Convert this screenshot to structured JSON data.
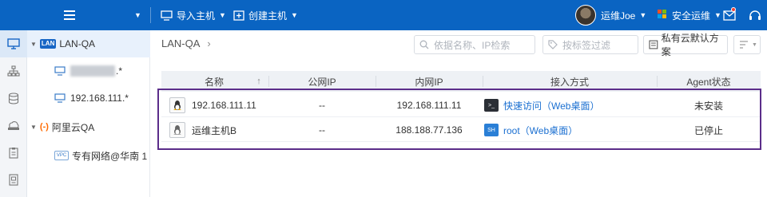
{
  "topbar": {
    "import_host": "导入主机",
    "create_host": "创建主机",
    "user_name": "运维Joe",
    "app_switch": "安全运维",
    "colors": {
      "bar": "#0a64c2",
      "badge": "#f04134"
    }
  },
  "rail": [
    "desktop-icon",
    "network-icon",
    "database-icon",
    "cloud-drive-icon",
    "clipboard-icon",
    "document-icon"
  ],
  "tree": {
    "groups": [
      {
        "tag": "LAN",
        "label": "LAN-QA",
        "children": [
          {
            "label": ".*"
          },
          {
            "label": "192.168.111.*"
          }
        ]
      },
      {
        "tag": "(-)",
        "label": "阿里云QA",
        "children": [
          {
            "tag": "VPC",
            "label": "专有网络@华南 1"
          }
        ]
      }
    ]
  },
  "breadcrumb": "LAN-QA",
  "search": {
    "placeholder": "依据名称、IP检索"
  },
  "tag_filter": {
    "placeholder": "按标签过滤"
  },
  "plan_select": {
    "value": "私有云默认方案"
  },
  "table": {
    "columns": [
      "名称",
      "公网IP",
      "内网IP",
      "接入方式",
      "Agent状态"
    ],
    "sort_indicator": "↑",
    "rows": [
      {
        "name": "192.168.111.11",
        "public_ip": "--",
        "private_ip": "192.168.111.11",
        "access": "快速访问（Web桌面）",
        "agent": "未安装"
      },
      {
        "name": "运维主机B",
        "public_ip": "--",
        "private_ip": "188.188.77.136",
        "access": "root（Web桌面）",
        "agent": "已停止"
      }
    ]
  }
}
